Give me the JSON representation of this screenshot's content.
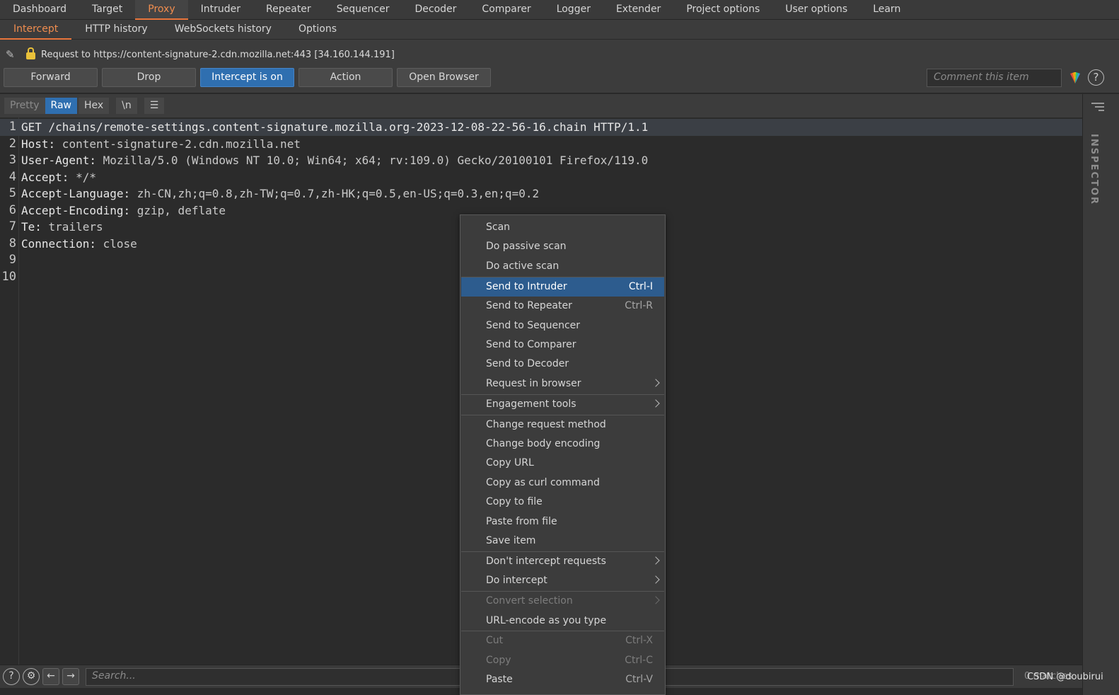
{
  "top_tabs": [
    "Dashboard",
    "Target",
    "Proxy",
    "Intruder",
    "Repeater",
    "Sequencer",
    "Decoder",
    "Comparer",
    "Logger",
    "Extender",
    "Project options",
    "User options",
    "Learn"
  ],
  "sub_tabs": [
    "Intercept",
    "HTTP history",
    "WebSockets history",
    "Options"
  ],
  "request_info": "Request to https://content-signature-2.cdn.mozilla.net:443  [34.160.144.191]",
  "buttons": {
    "forward": "Forward",
    "drop": "Drop",
    "intercept": "Intercept is on",
    "action": "Action",
    "open_browser": "Open Browser"
  },
  "comment_placeholder": "Comment this item",
  "help_glyph": "?",
  "view_tabs": {
    "pretty": "Pretty",
    "raw": "Raw",
    "hex": "Hex",
    "newline": "\\n"
  },
  "editor_lines": [
    {
      "n": "1",
      "h": "GET /chains/remote-settings.content-signature.mozilla.org-2023-12-08-22-56-16.chain HTTP/1.1",
      "v": ""
    },
    {
      "n": "2",
      "h": "Host:",
      "v": " content-signature-2.cdn.mozilla.net"
    },
    {
      "n": "3",
      "h": "User-Agent:",
      "v": " Mozilla/5.0 (Windows NT 10.0; Win64; x64; rv:109.0) Gecko/20100101 Firefox/119.0"
    },
    {
      "n": "4",
      "h": "Accept:",
      "v": " */*"
    },
    {
      "n": "5",
      "h": "Accept-Language:",
      "v": " zh-CN,zh;q=0.8,zh-TW;q=0.7,zh-HK;q=0.5,en-US;q=0.3,en;q=0.2"
    },
    {
      "n": "6",
      "h": "Accept-Encoding:",
      "v": " gzip, deflate"
    },
    {
      "n": "7",
      "h": "Te:",
      "v": " trailers"
    },
    {
      "n": "8",
      "h": "Connection:",
      "v": " close"
    },
    {
      "n": "9",
      "h": "",
      "v": ""
    },
    {
      "n": "10",
      "h": "",
      "v": ""
    }
  ],
  "inspector_label": "INSPECTOR",
  "search_placeholder": "Search...",
  "matches_text": "0 matches",
  "watermark": "CSDN @doubirui",
  "context_menu": {
    "groups": [
      [
        {
          "label": "Scan"
        },
        {
          "label": "Do passive scan"
        },
        {
          "label": "Do active scan"
        }
      ],
      [
        {
          "label": "Send to Intruder",
          "shortcut": "Ctrl-I",
          "selected": true
        },
        {
          "label": "Send to Repeater",
          "shortcut": "Ctrl-R"
        },
        {
          "label": "Send to Sequencer"
        },
        {
          "label": "Send to Comparer"
        },
        {
          "label": "Send to Decoder"
        },
        {
          "label": "Request in browser",
          "submenu": true
        }
      ],
      [
        {
          "label": "Engagement tools",
          "submenu": true
        }
      ],
      [
        {
          "label": "Change request method"
        },
        {
          "label": "Change body encoding"
        },
        {
          "label": "Copy URL"
        },
        {
          "label": "Copy as curl command"
        },
        {
          "label": "Copy to file"
        },
        {
          "label": "Paste from file"
        },
        {
          "label": "Save item"
        }
      ],
      [
        {
          "label": "Don't intercept requests",
          "submenu": true
        },
        {
          "label": "Do intercept",
          "submenu": true
        }
      ],
      [
        {
          "label": "Convert selection",
          "submenu": true,
          "disabled": true
        },
        {
          "label": "URL-encode as you type"
        }
      ],
      [
        {
          "label": "Cut",
          "shortcut": "Ctrl-X",
          "disabled": true
        },
        {
          "label": "Copy",
          "shortcut": "Ctrl-C",
          "disabled": true
        },
        {
          "label": "Paste",
          "shortcut": "Ctrl-V"
        }
      ]
    ]
  },
  "colors": {
    "accent_orange": "#e8743b",
    "primary_blue": "#2f6fb0",
    "selected_menu": "#2d5c8e"
  }
}
